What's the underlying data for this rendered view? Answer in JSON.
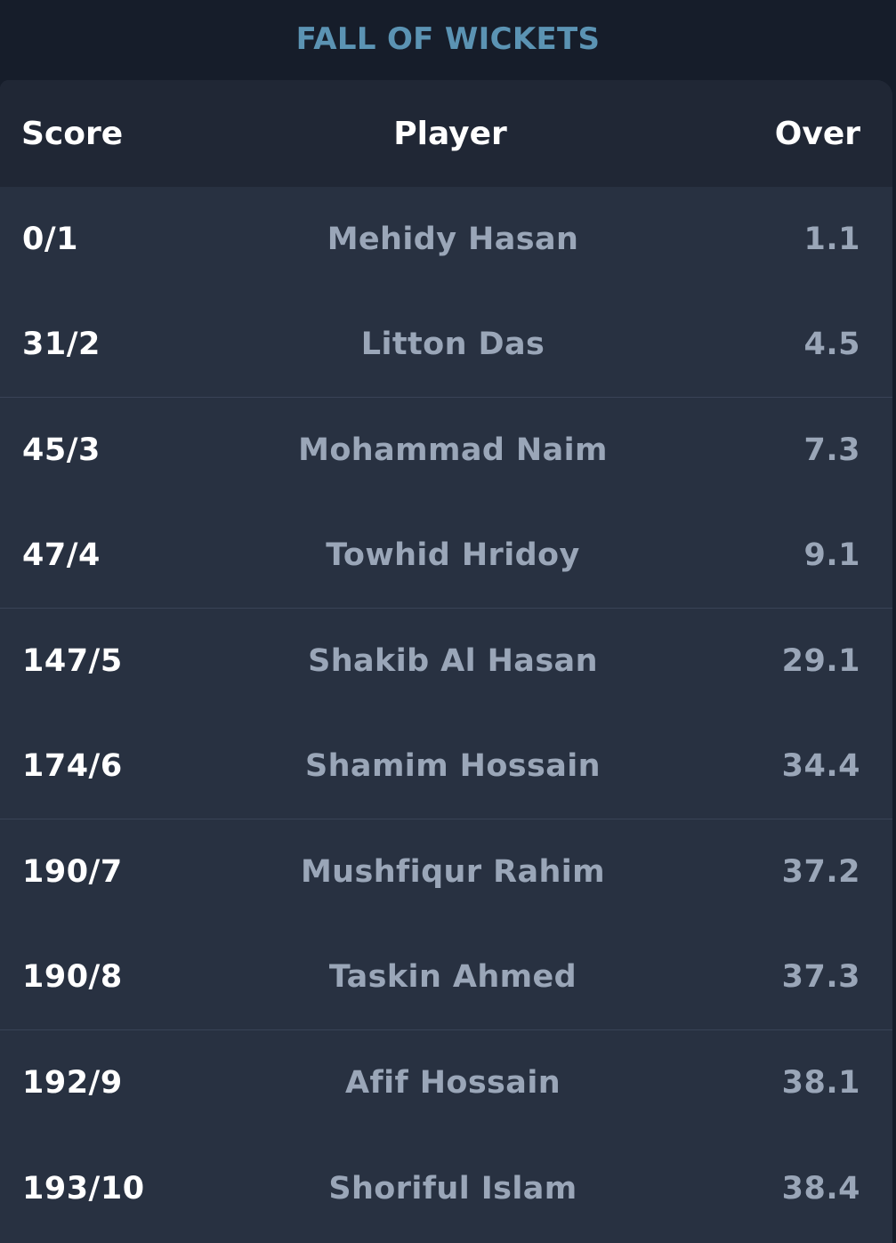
{
  "title": "FALL OF WICKETS",
  "columns": {
    "score": "Score",
    "player": "Player",
    "over": "Over"
  },
  "rows": [
    {
      "score": "0/1",
      "player": "Mehidy Hasan",
      "over": "1.1"
    },
    {
      "score": "31/2",
      "player": "Litton Das",
      "over": "4.5"
    },
    {
      "score": "45/3",
      "player": "Mohammad Naim",
      "over": "7.3"
    },
    {
      "score": "47/4",
      "player": "Towhid Hridoy",
      "over": "9.1"
    },
    {
      "score": "147/5",
      "player": "Shakib Al Hasan",
      "over": "29.1"
    },
    {
      "score": "174/6",
      "player": "Shamim Hossain",
      "over": "34.4"
    },
    {
      "score": "190/7",
      "player": "Mushfiqur Rahim",
      "over": "37.2"
    },
    {
      "score": "190/8",
      "player": "Taskin Ahmed",
      "over": "37.3"
    },
    {
      "score": "192/9",
      "player": "Afif Hossain",
      "over": "38.1"
    },
    {
      "score": "193/10",
      "player": "Shoriful Islam",
      "over": "38.4"
    }
  ]
}
